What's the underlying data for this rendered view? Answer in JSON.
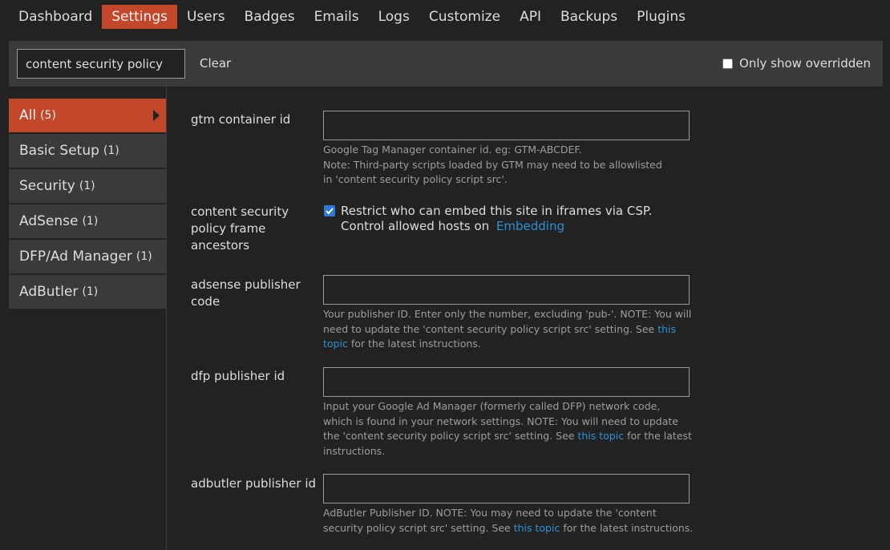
{
  "nav": {
    "items": [
      {
        "label": "Dashboard"
      },
      {
        "label": "Settings"
      },
      {
        "label": "Users"
      },
      {
        "label": "Badges"
      },
      {
        "label": "Emails"
      },
      {
        "label": "Logs"
      },
      {
        "label": "Customize"
      },
      {
        "label": "API"
      },
      {
        "label": "Backups"
      },
      {
        "label": "Plugins"
      }
    ],
    "active": "Settings"
  },
  "filter": {
    "search_value": "content security policy",
    "clear_label": "Clear",
    "only_overridden_label": "Only show overridden",
    "only_overridden_checked": false
  },
  "sidebar": {
    "items": [
      {
        "label": "All",
        "count": "(5)"
      },
      {
        "label": "Basic Setup",
        "count": "(1)"
      },
      {
        "label": "Security",
        "count": "(1)"
      },
      {
        "label": "AdSense",
        "count": "(1)"
      },
      {
        "label": "DFP/Ad Manager",
        "count": "(1)"
      },
      {
        "label": "AdButler",
        "count": "(1)"
      }
    ]
  },
  "settings": {
    "gtm": {
      "label": "gtm container id",
      "value": "",
      "desc_line1": "Google Tag Manager container id. eg: GTM-ABCDEF.",
      "desc_line2": "Note: Third-party scripts loaded by GTM may need to be allowlisted in 'content security policy script src'."
    },
    "csp_frame": {
      "label": "content security policy frame ancestors",
      "checked": true,
      "text": "Restrict who can embed this site in iframes via CSP. Control allowed hosts on",
      "link": "Embedding"
    },
    "adsense": {
      "label": "adsense publisher code",
      "value": "",
      "desc_pre": "Your publisher ID. Enter only the number, excluding 'pub-'. NOTE: You will need to update the 'content security policy script src' setting. See",
      "desc_link": "this topic",
      "desc_post": "for the latest instructions."
    },
    "dfp": {
      "label": "dfp publisher id",
      "value": "",
      "desc_pre": "Input your Google Ad Manager (formerly called DFP) network code, which is found in your network settings. NOTE: You will need to update the 'content security policy script src' setting. See",
      "desc_link": "this topic",
      "desc_post": "for the latest instructions."
    },
    "adbutler": {
      "label": "adbutler publisher id",
      "value": "",
      "desc_pre": "AdButler Publisher ID. NOTE: You may need to update the 'content security policy script src' setting. See",
      "desc_link": "this topic",
      "desc_post": "for the latest instructions."
    }
  },
  "colors": {
    "accent": "#c5472a",
    "link": "#2a92d6",
    "background": "#222222",
    "panel": "#3a3a3a"
  }
}
